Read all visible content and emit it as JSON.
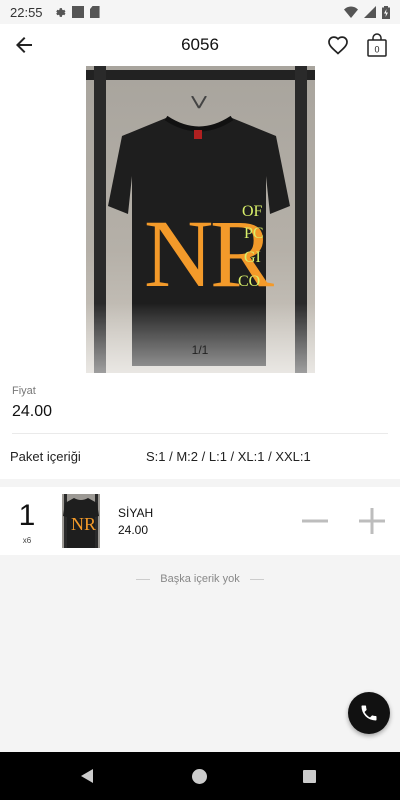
{
  "status_bar": {
    "time": "22:55"
  },
  "app_bar": {
    "title": "6056",
    "cart_count": "0"
  },
  "gallery": {
    "counter": "1/1",
    "print_text": "NR"
  },
  "price": {
    "label": "Fiyat",
    "value": "24.00"
  },
  "package": {
    "label": "Paket içeriği",
    "value": "S:1 / M:2 / L:1 / XL:1 / XXL:1"
  },
  "variant": {
    "quantity": "1",
    "multiplier": "x6",
    "color": "SİYAH",
    "price": "24.00"
  },
  "footer": {
    "no_more": "Başka içerik yok"
  },
  "colors": {
    "accent": "#f39a2a",
    "shirt": "#1e1e1e",
    "fab": "#111111"
  }
}
